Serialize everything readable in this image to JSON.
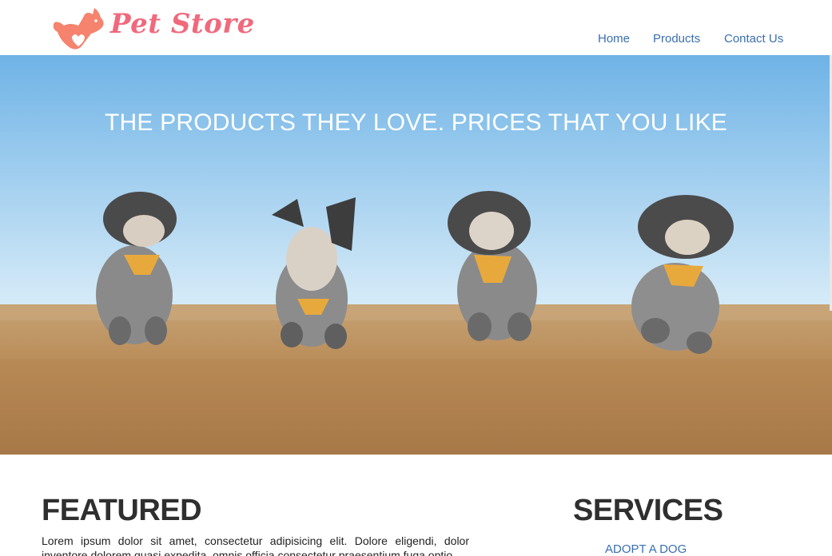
{
  "brand": {
    "name": "Pet Store",
    "color": "#f0697c"
  },
  "nav": {
    "items": [
      "Home",
      "Products",
      "Contact Us"
    ]
  },
  "hero": {
    "title": "THE PRODUCTS THEY LOVE. PRICES THAT YOU LIKE"
  },
  "featured": {
    "title": "FEATURED",
    "text": "Lorem ipsum dolor sit amet, consectetur adipisicing elit. Dolore eligendi, dolor inventore dolorem quasi expedita, omnis officia consectetur praesentium fuga optio."
  },
  "services": {
    "title": "SERVICES",
    "links": [
      "ADOPT A DOG"
    ]
  }
}
